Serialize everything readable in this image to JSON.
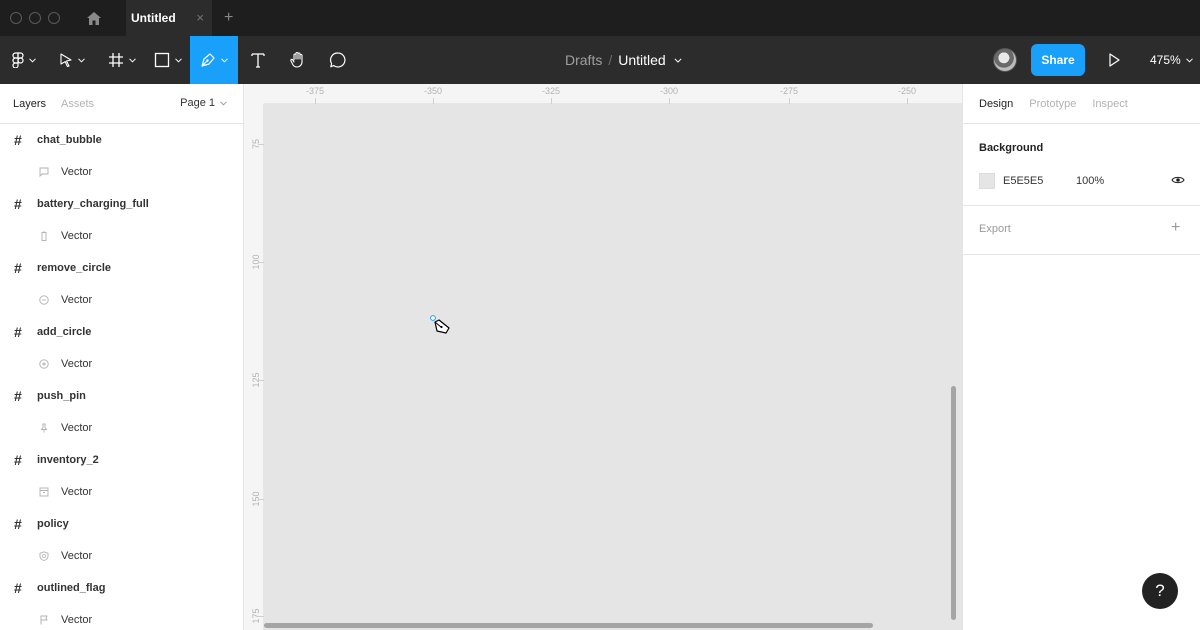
{
  "titlebar": {
    "tab_label": "Untitled",
    "tab_close": "×",
    "tab_add": "+"
  },
  "toolbar": {
    "tools": [
      {
        "name": "main-menu",
        "icon": "figma-logo-icon"
      },
      {
        "name": "move-tool",
        "icon": "pointer-icon"
      },
      {
        "name": "frame-tool",
        "icon": "hash-frame-icon"
      },
      {
        "name": "shape-tool",
        "icon": "rectangle-icon"
      },
      {
        "name": "pen-tool",
        "icon": "pen-icon",
        "active": true
      },
      {
        "name": "text-tool",
        "icon": "text-icon"
      },
      {
        "name": "hand-tool",
        "icon": "hand-icon"
      },
      {
        "name": "comment-tool",
        "icon": "comment-icon"
      }
    ],
    "breadcrumb_parent": "Drafts",
    "breadcrumb_separator": "/",
    "file_name": "Untitled",
    "share_label": "Share",
    "zoom": "475%",
    "accent_color": "#18a0fb"
  },
  "left_panel": {
    "tab_layers": "Layers",
    "tab_assets": "Assets",
    "page_selector": "Page 1",
    "layers": [
      {
        "name": "chat_bubble",
        "child": "Vector",
        "child_icon": "chat-bubble-icon"
      },
      {
        "name": "battery_charging_full",
        "child": "Vector",
        "child_icon": "battery-icon"
      },
      {
        "name": "remove_circle",
        "child": "Vector",
        "child_icon": "remove-circle-icon"
      },
      {
        "name": "add_circle",
        "child": "Vector",
        "child_icon": "add-circle-icon"
      },
      {
        "name": "push_pin",
        "child": "Vector",
        "child_icon": "push-pin-icon"
      },
      {
        "name": "inventory_2",
        "child": "Vector",
        "child_icon": "inventory-icon"
      },
      {
        "name": "policy",
        "child": "Vector",
        "child_icon": "policy-icon"
      },
      {
        "name": "outlined_flag",
        "child": "Vector",
        "child_icon": "flag-icon"
      }
    ]
  },
  "canvas": {
    "background_color": "#e5e5e5",
    "ruler_top_labels": [
      "-375",
      "-350",
      "-325",
      "-300",
      "-275",
      "-250"
    ],
    "ruler_left_labels": [
      "75",
      "100",
      "125",
      "150",
      "175"
    ]
  },
  "right_panel": {
    "tab_design": "Design",
    "tab_prototype": "Prototype",
    "tab_inspect": "Inspect",
    "background_title": "Background",
    "background_hex": "E5E5E5",
    "background_opacity": "100%",
    "export_title": "Export"
  },
  "help_label": "?"
}
